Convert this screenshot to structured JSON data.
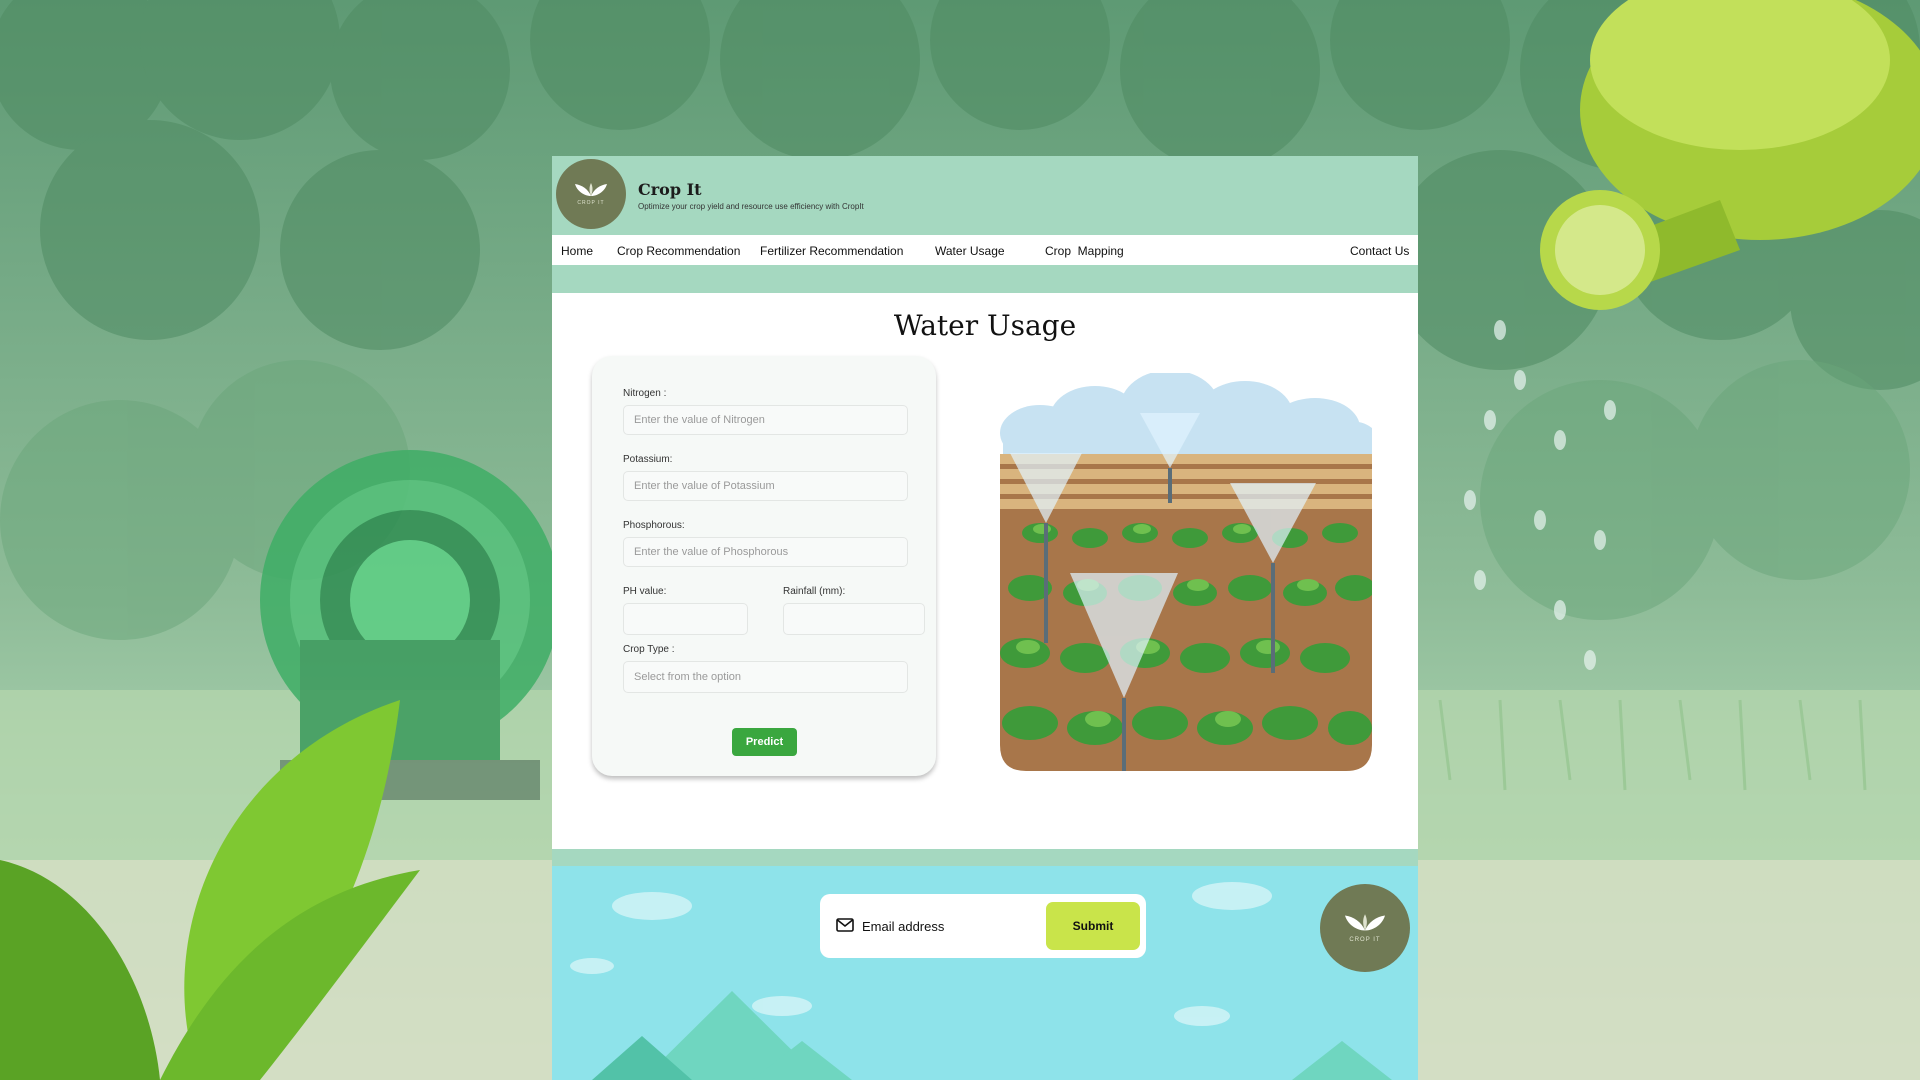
{
  "brand": {
    "name": "Crop It",
    "tagline": "Optimize your crop yield and resource use efficiency with CropIt",
    "logo_text": "CROP IT"
  },
  "nav": {
    "items": [
      {
        "label": "Home"
      },
      {
        "label": "Crop Recommendation"
      },
      {
        "label": "Fertilizer Recommendation"
      },
      {
        "label": "Water Usage"
      },
      {
        "label": "Crop  Mapping"
      },
      {
        "label": "Contact Us"
      }
    ]
  },
  "main": {
    "title": "Water Usage",
    "form": {
      "nitrogen": {
        "label": "Nitrogen :",
        "placeholder": "Enter the value of Nitrogen"
      },
      "potassium": {
        "label": "Potassium:",
        "placeholder": "Enter the value of Potassium"
      },
      "phosphorous": {
        "label": "Phosphorous:",
        "placeholder": "Enter the value of Phosphorous"
      },
      "ph": {
        "label": "PH value:",
        "placeholder": ""
      },
      "rainfall": {
        "label": "Rainfall (mm):",
        "placeholder": ""
      },
      "crop_type": {
        "label": "Crop Type :",
        "placeholder": "Select from the option"
      },
      "predict_label": "Predict"
    }
  },
  "footer": {
    "email_placeholder": "Email address",
    "submit_label": "Submit",
    "logo_text": "CROP IT"
  },
  "colors": {
    "header_bg": "#a5d8c0",
    "predict_button": "#3aa73f",
    "submit_button": "#c9e44a",
    "logo_bg": "#707a55",
    "footer_sky": "#8ee3ea"
  },
  "icons": [
    "leaf-logo-icon",
    "mail-icon"
  ]
}
